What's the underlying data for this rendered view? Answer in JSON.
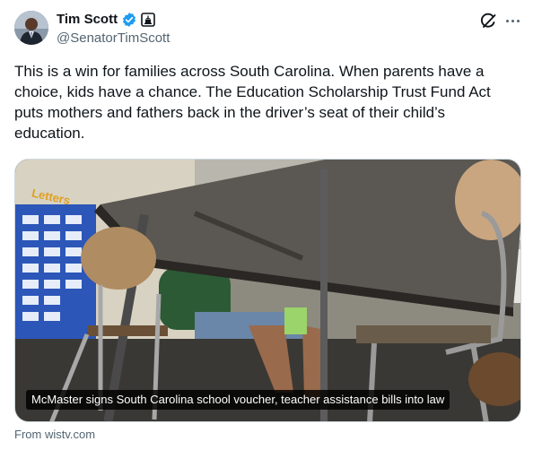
{
  "author": {
    "display_name": "Tim Scott",
    "handle": "@SenatorTimScott",
    "verified": true,
    "badge": "government-building-icon"
  },
  "tweet": {
    "text": "This is a win for families across South Carolina. When parents have a choice, kids have a chance. The Education Scholarship Trust Fund Act puts mothers and fathers back in the driver’s seat of their child’s education."
  },
  "media": {
    "caption": "McMaster signs South Carolina school voucher, teacher assistance bills into law",
    "bulletin_board_label": "Letters"
  },
  "card_source": "From wistv.com",
  "colors": {
    "text_primary": "#0f1419",
    "text_secondary": "#536471",
    "verified_blue": "#1d9bf0",
    "border": "#cfd9de"
  }
}
